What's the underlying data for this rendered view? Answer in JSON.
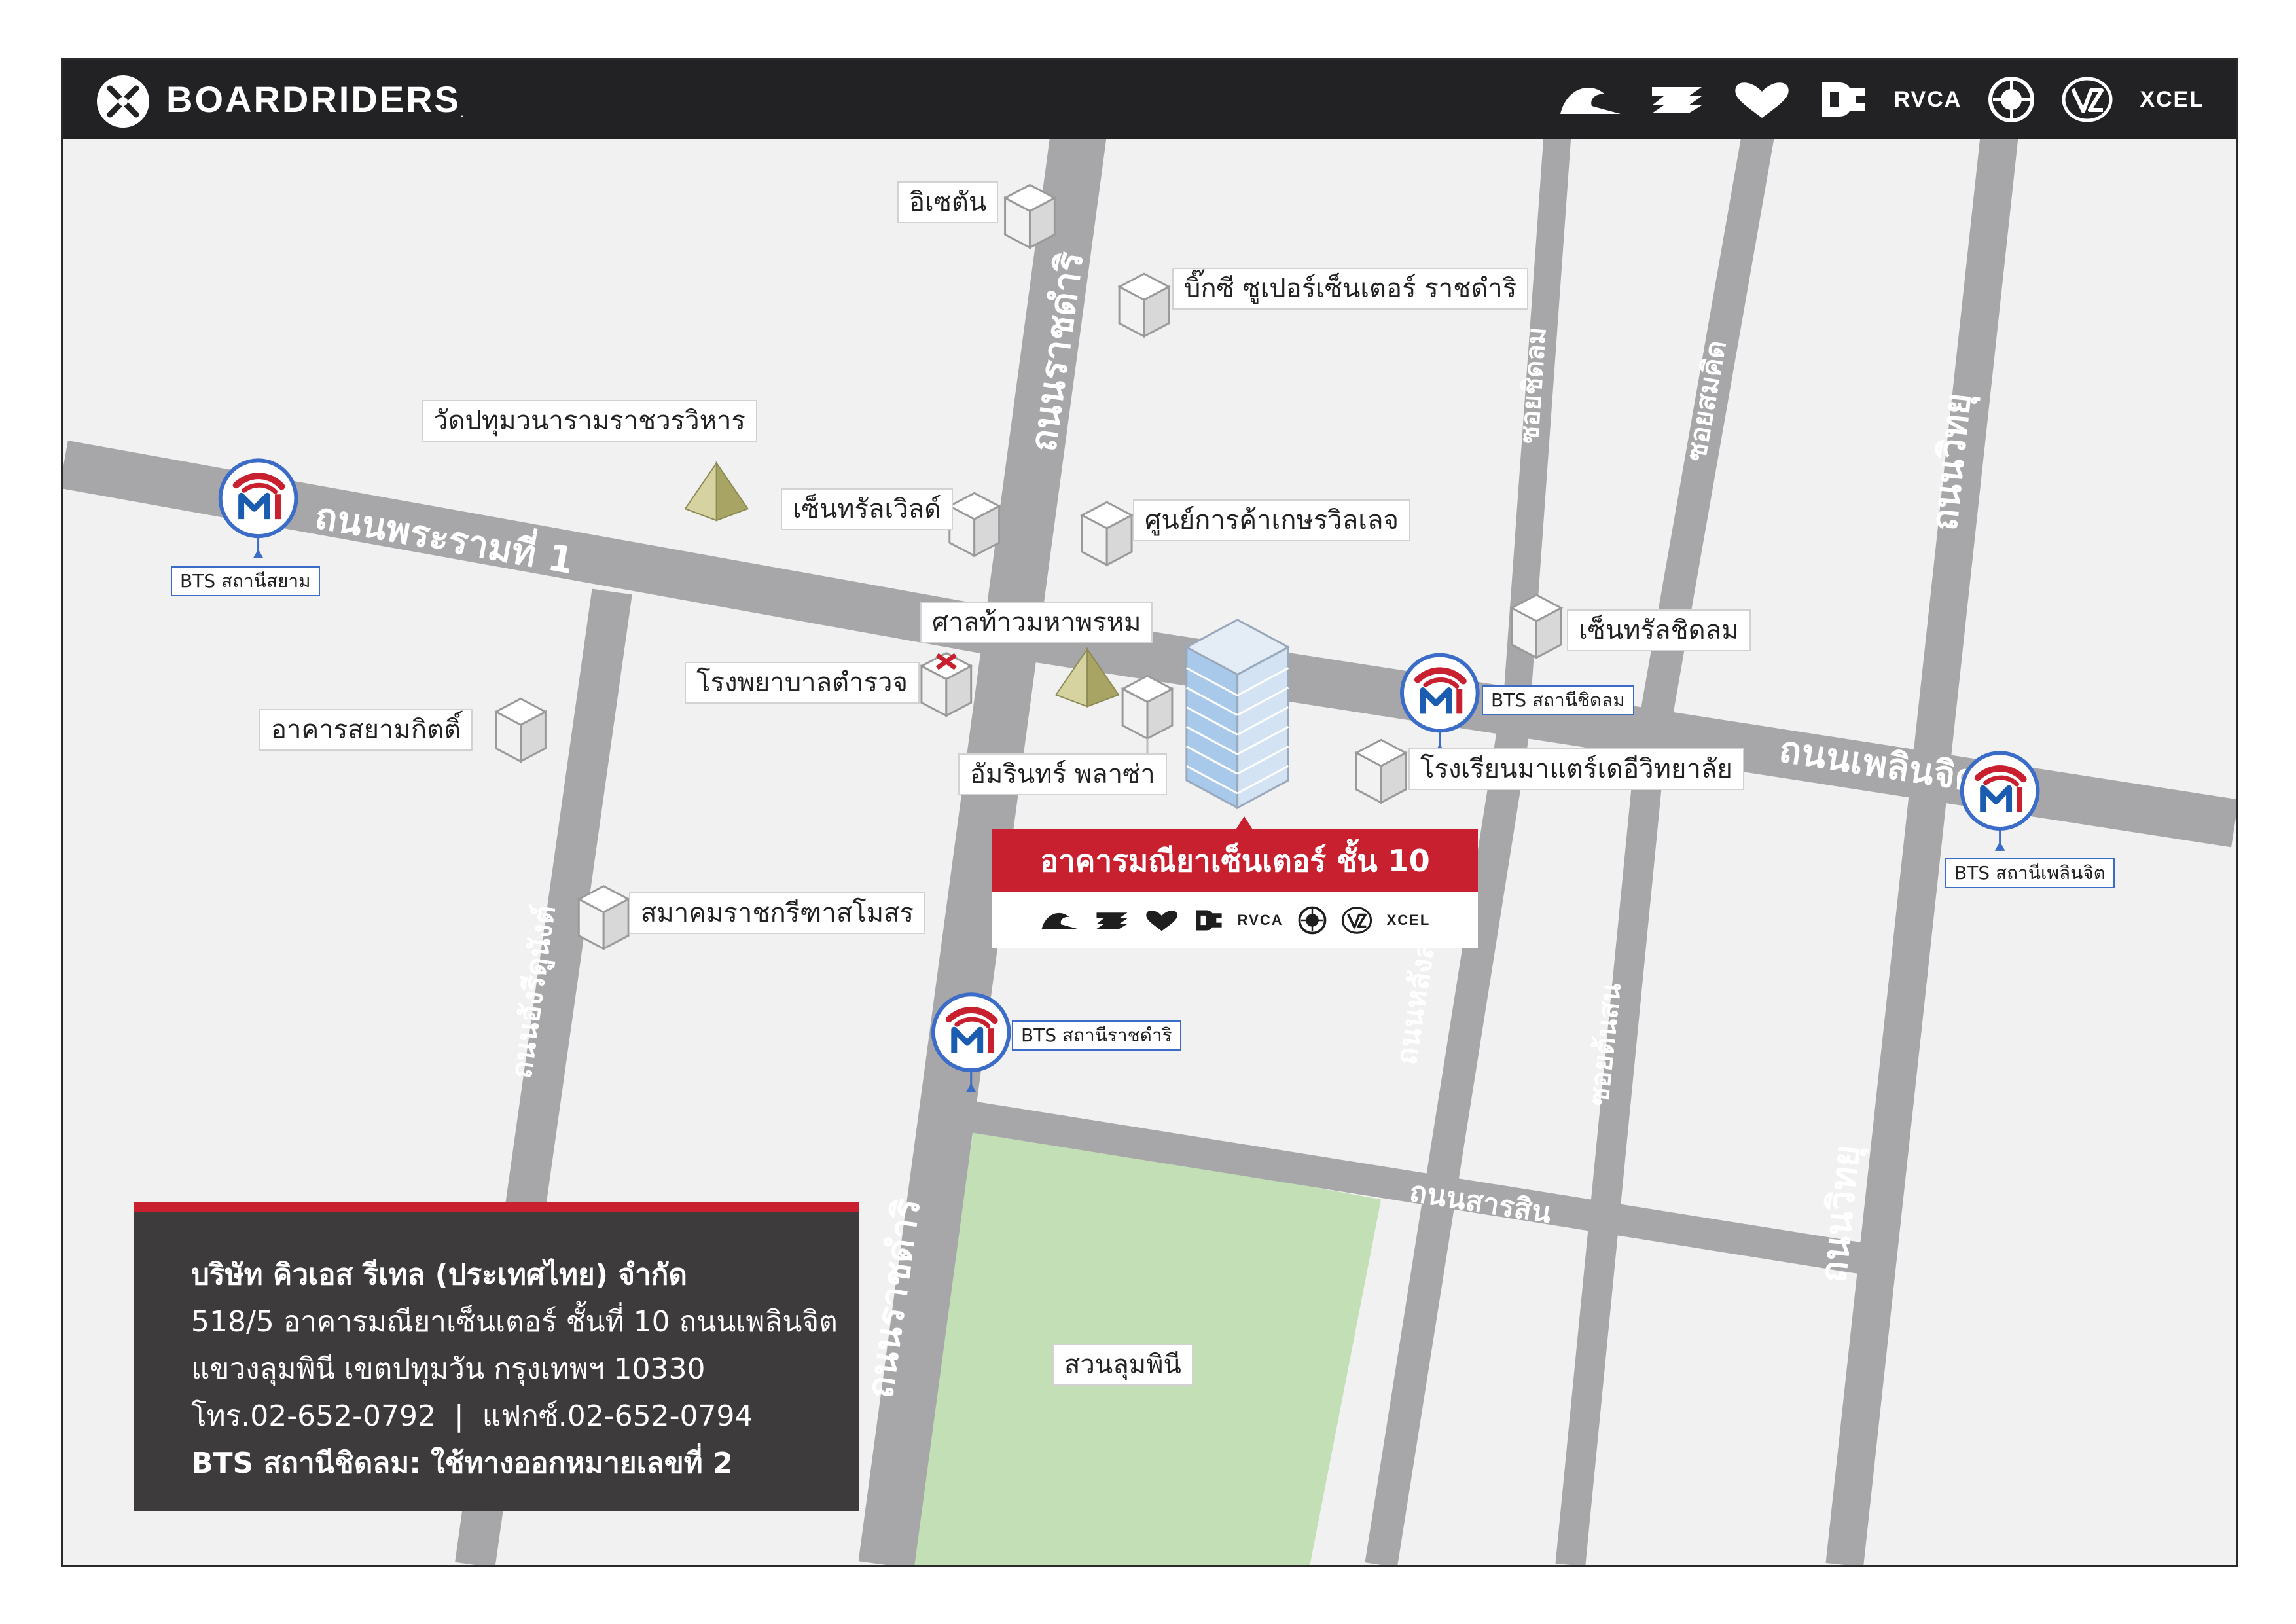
{
  "header": {
    "brand_name": "BOARDRIDERS",
    "brand_mark": ".",
    "brands": [
      "quiksilver-icon",
      "billabong-icon",
      "roxy-icon",
      "dc-icon",
      "RVCA",
      "element-icon",
      "vonzipper-icon",
      "XCEL"
    ]
  },
  "colors": {
    "accent": "#c8202f",
    "road": "#a7a7a9",
    "park": "#c3dfb6",
    "header": "#222224",
    "bts_blue": "#3a6cc8"
  },
  "target": {
    "title": "อาคารมณียาเซ็นเตอร์ ชั้น 10",
    "brands": [
      "quiksilver-icon",
      "billabong-icon",
      "roxy-icon",
      "dc-icon",
      "RVCA",
      "element-icon",
      "vonzipper-icon",
      "XCEL"
    ]
  },
  "landmarks": {
    "isetan": "อิเซตัน",
    "big_c": "บิ๊กซี ซูเปอร์เซ็นเตอร์ ราชดำริ",
    "wat_pathum": "วัดปทุมวนารามราชวรวิหาร",
    "central_world": "เซ็นทรัลเวิลด์",
    "gaysorn": "ศูนย์การค้าเกษรวิลเลจ",
    "erawan": "ศาลท้าวมหาพรหม",
    "police_hospital": "โรงพยาบาลตำรวจ",
    "siam_kit": "อาคารสยามกิตติ์",
    "amarin": "อัมรินทร์ พลาซ่า",
    "central_chidlom": "เซ็นทรัลชิดลม",
    "mater_dei": "โรงเรียนมาแตร์เดอีวิทยาลัย",
    "rbsc": "สมาคมราชกรีฑาสโมสร",
    "lumpini_park": "สวนลุมพินี"
  },
  "bts": {
    "siam": "BTS สถานีสยาม",
    "chidlom": "BTS สถานีชิดลม",
    "ploenchit": "BTS สถานีเพลินจิต",
    "ratchadamri": "BTS สถานีราชดำริ"
  },
  "roads": {
    "rama1": "ถนนพระรามที่ 1",
    "ploenchit": "ถนนเพลินจิต",
    "ratchadamri_top": "ถนนราชดำริ",
    "ratchadamri_bottom": "ถนนราชดำริ",
    "henri_dunant": "ถนนอังรีดูนังต์",
    "soi_chidlom": "ซอยชิดลม",
    "soi_somkid": "ซอยสมคิด",
    "wireless_top": "ถนนวิทยุ",
    "wireless_bottom": "ถนนวิทยุ",
    "lang_suan": "ถนนหลังสวน",
    "soi_tonson": "ซอยต้นสน",
    "sarasin": "ถนนสารสิน"
  },
  "info": {
    "company": "บริษัท คิวเอส รีเทล (ประเทศไทย) จำกัด",
    "address1": "518/5 อาคารมณียาเซ็นเตอร์ ชั้นที่ 10 ถนนเพลินจิต",
    "address2": "แขวงลุมพินี เขตปทุมวัน กรุงเทพฯ 10330",
    "phone": "โทร.02-652-0792  |  แฟกซ์.02-652-0794",
    "bts_note": "BTS สถานีชิดลม: ใช้ทางออกหมายเลขที่ 2"
  }
}
